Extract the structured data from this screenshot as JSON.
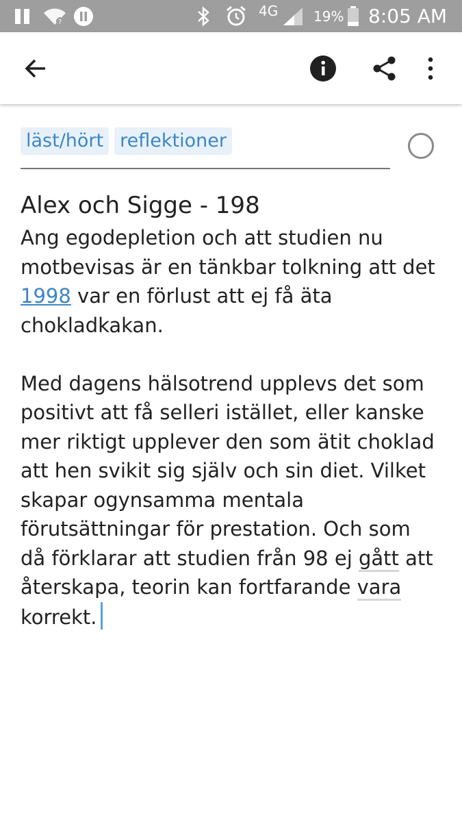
{
  "status_bar": {
    "battery_percent": "19%",
    "time": "8:05 AM",
    "network": "4G"
  },
  "toolbar": {
    "back_icon": "arrow-left-icon",
    "info_icon": "info-icon",
    "share_icon": "share-icon",
    "more_icon": "more-vert-icon"
  },
  "note": {
    "tags": [
      "läst/hört",
      "reflektioner"
    ],
    "title": "Alex och Sigge - 198",
    "p1_before": "Ang egodepletion och att studien nu motbevisas är en tänkbar tolkning att det ",
    "p1_link": "1998",
    "p1_after": " var en förlust att ej få äta chokladkakan.",
    "p2_a": "Med dagens hälsotrend upplevs det som positivt att få selleri istället, eller kanske mer riktigt upplever den som ätit choklad att hen svikit sig själv och sin diet. Vilket skapar ogynsamma mentala förutsättningar för prestation.  Och som då förklarar att studien från 98 ej ",
    "p2_word1": "gått",
    "p2_b": " att återskapa, teorin kan fortfarande ",
    "p2_word2": "vara",
    "p2_c": " korrekt."
  }
}
